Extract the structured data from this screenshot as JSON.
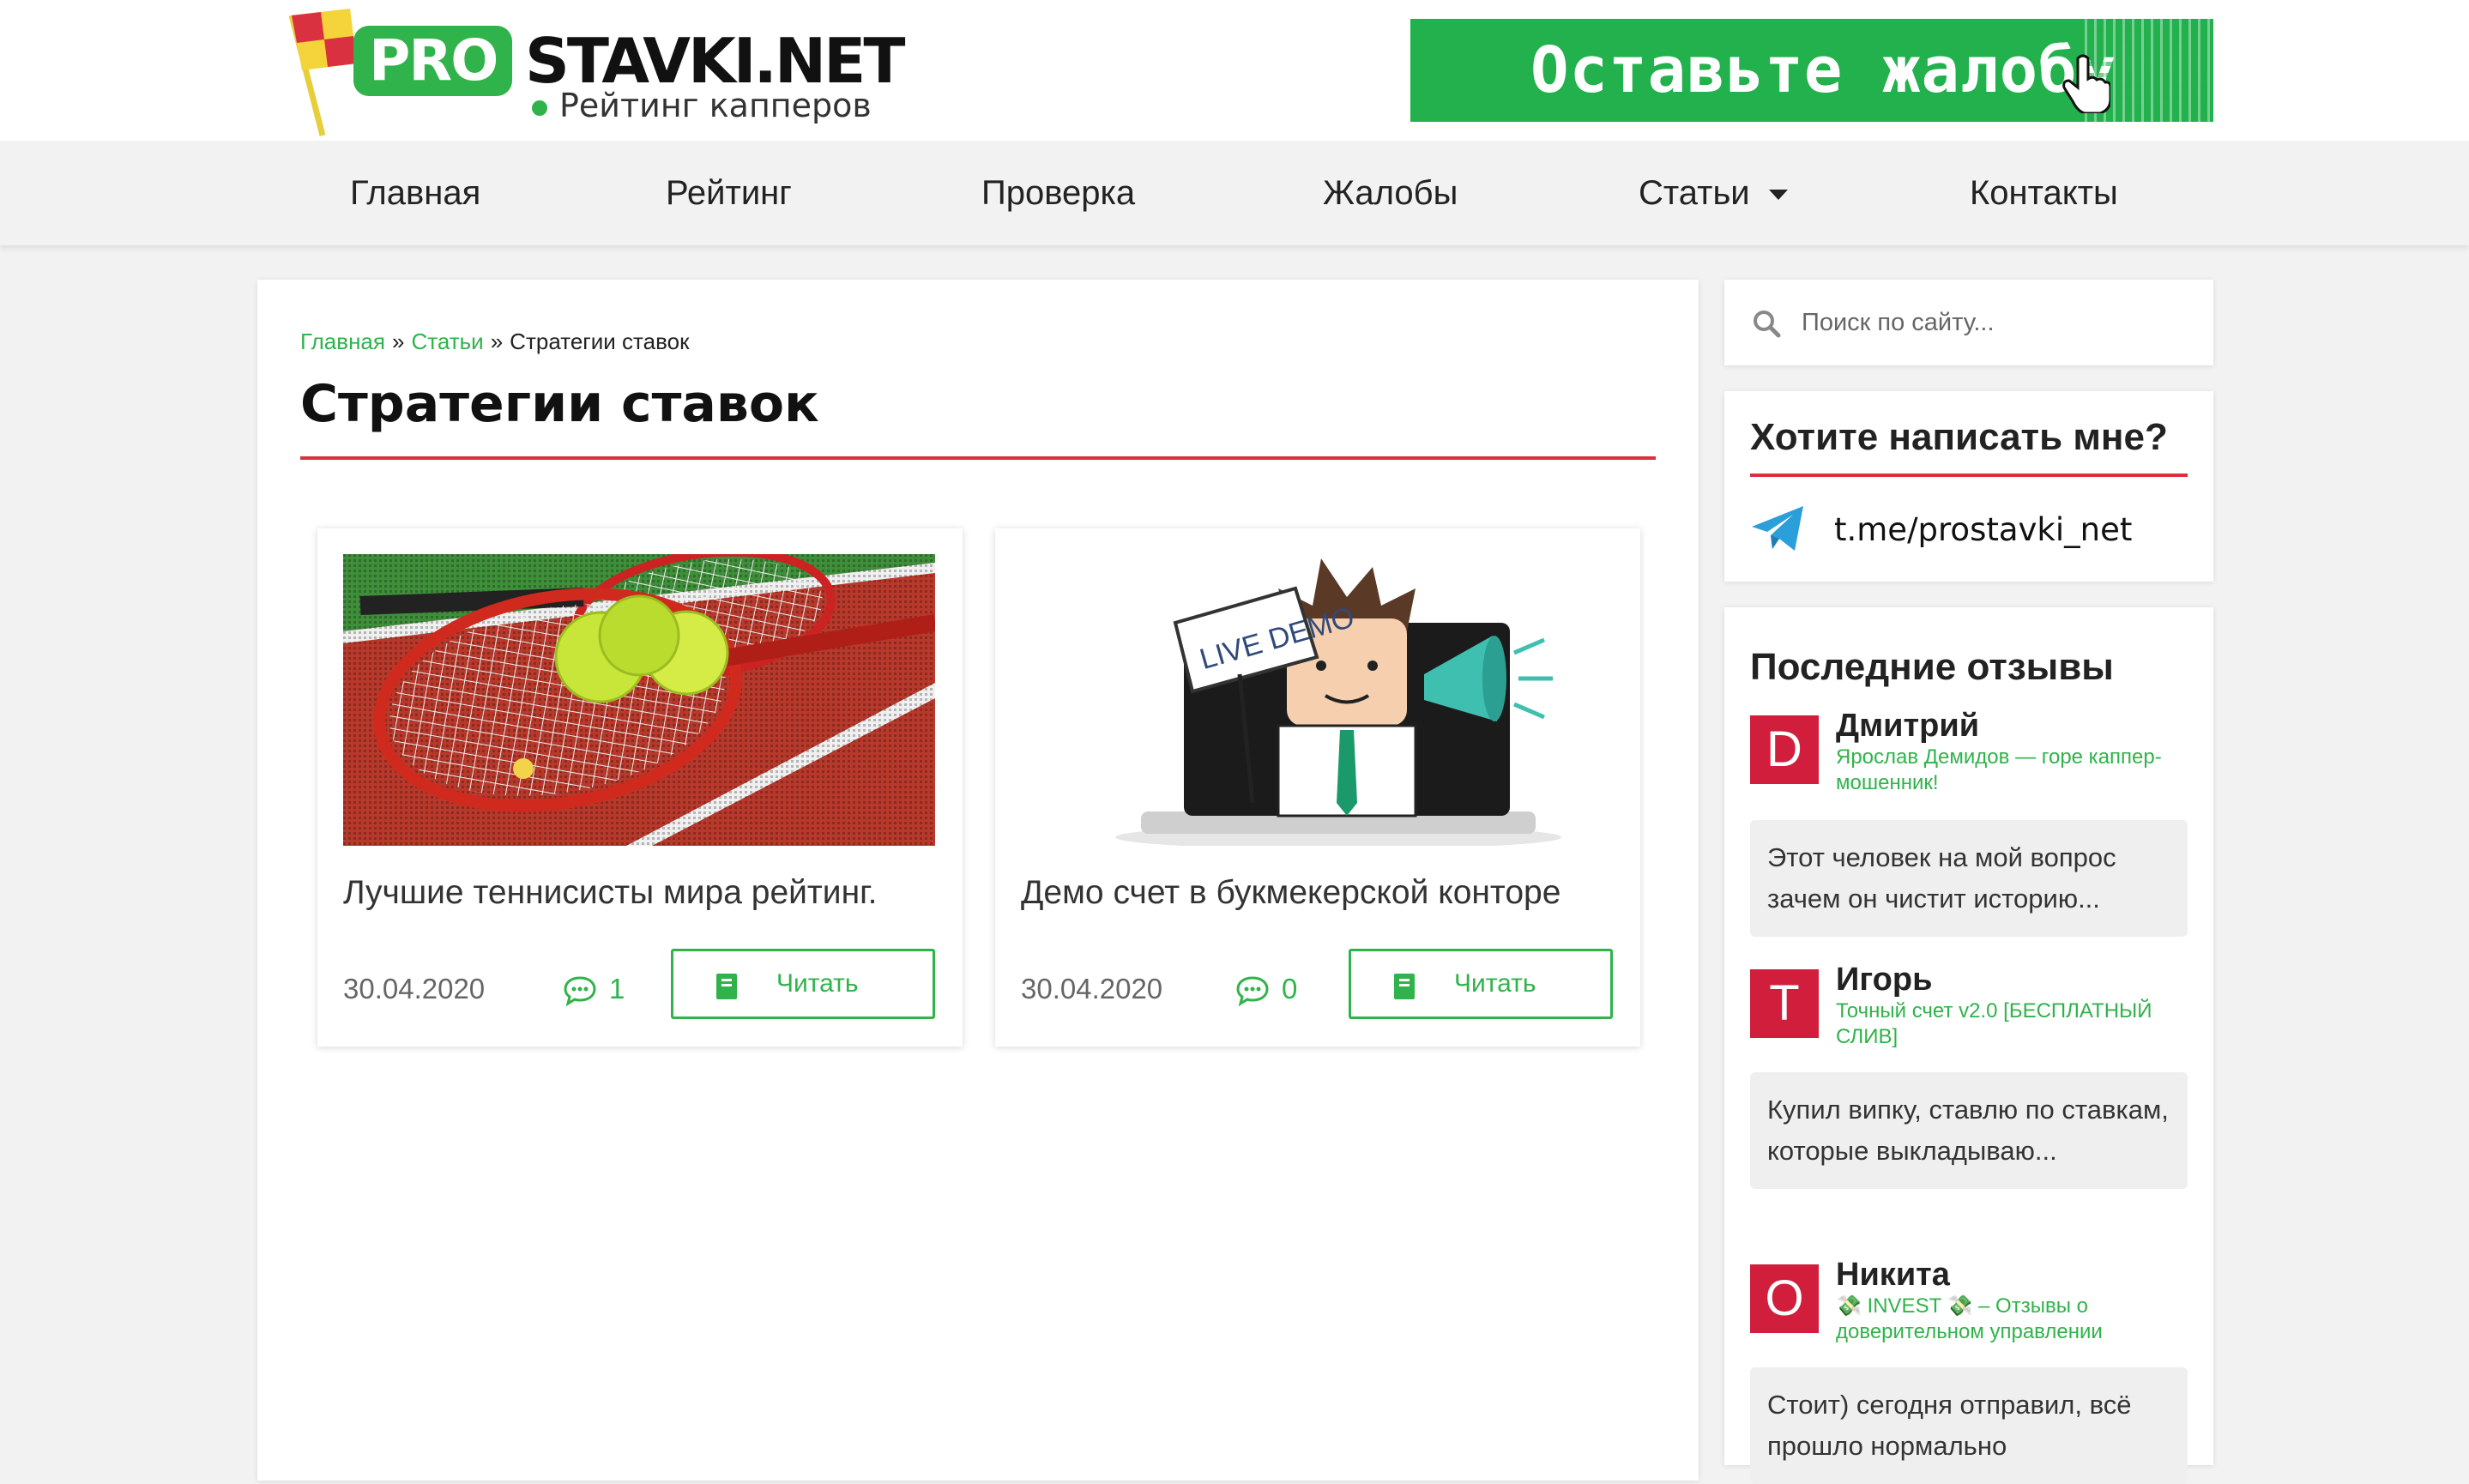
{
  "header": {
    "logo_pro": "PRO",
    "logo_main": "STAVKI.NET",
    "logo_sub": "Рейтинг капперов",
    "banner_text": "Оставьте жалобу"
  },
  "nav": {
    "items": [
      {
        "label": "Главная"
      },
      {
        "label": "Рейтинг"
      },
      {
        "label": "Проверка"
      },
      {
        "label": "Жалобы"
      },
      {
        "label": "Статьи"
      },
      {
        "label": "Контакты"
      }
    ]
  },
  "breadcrumb": {
    "home": "Главная",
    "articles": "Статьи",
    "current": "Стратегии ставок",
    "separator": "»"
  },
  "page": {
    "title": "Стратегии ставок"
  },
  "posts": [
    {
      "title": "Лучшие теннисисты мира рейтинг.",
      "date": "30.04.2020",
      "comments": "1",
      "read_label": "Читать",
      "image": "tennis-rackets-and-balls"
    },
    {
      "title": "Демо счет в букмекерской конторе",
      "date": "30.04.2020",
      "comments": "0",
      "read_label": "Читать",
      "image": "live-demo-illustration",
      "image_sign": "LIVE DEMO"
    }
  ],
  "sidebar": {
    "search": {
      "placeholder": "Поиск по сайту..."
    },
    "contact": {
      "title": "Хотите написать мне?",
      "link": "t.me/prostavki_net"
    },
    "reviews": {
      "title": "Последние отзывы",
      "items": [
        {
          "initial": "D",
          "name": "Дмитрий",
          "target": "Ярослав Демидов — горе каппер-мошенник!",
          "text": "Этот человек на мой вопрос зачем он чистит историю..."
        },
        {
          "initial": "T",
          "name": "Игорь",
          "target": "Точный счет v2.0 [БЕСПЛАТНЫЙ СЛИВ]",
          "text": "Купил випку, ставлю по ставкам, которые выкладываю..."
        },
        {
          "initial": "O",
          "name": "Никита",
          "target": "💸 INVEST 💸 – Отзывы о доверительном управлении",
          "text": "Стоит) сегодня отправил, всё прошло нормально"
        }
      ]
    }
  },
  "colors": {
    "green": "#2fb34a",
    "red": "#d9313f",
    "avatar": "#d01e3c",
    "banner": "#22b14c"
  }
}
